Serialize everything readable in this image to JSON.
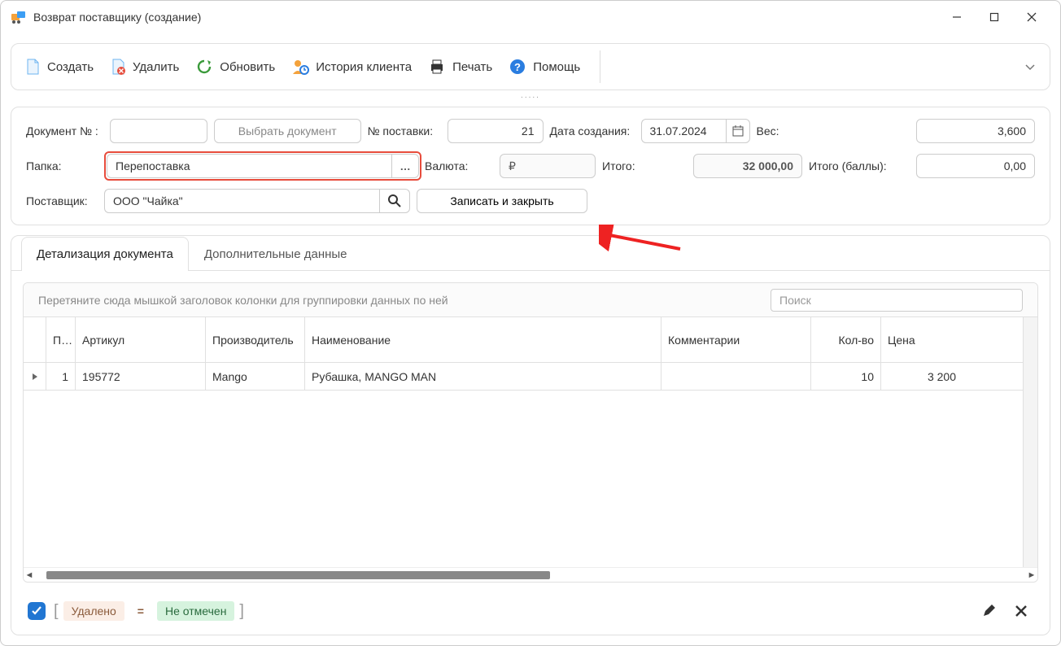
{
  "window": {
    "title": "Возврат поставщику (создание)"
  },
  "toolbar": {
    "create": "Создать",
    "delete": "Удалить",
    "refresh": "Обновить",
    "history": "История клиента",
    "print": "Печать",
    "help": "Помощь"
  },
  "form": {
    "doc_label": "Документ № :",
    "doc_value": "",
    "choose_doc": "Выбрать документ",
    "delivery_label": "№ поставки:",
    "delivery_value": "21",
    "date_label": "Дата создания:",
    "date_value": "31.07.2024",
    "weight_label": "Вес:",
    "weight_value": "3,600",
    "folder_label": "Папка:",
    "folder_value": "Перепоставка",
    "currency_label": "Валюта:",
    "currency_value": "₽",
    "total_label": "Итого:",
    "total_value": "32 000,00",
    "points_label": "Итого (баллы):",
    "points_value": "0,00",
    "supplier_label": "Поставщик:",
    "supplier_value": "ООО \"Чайка\"",
    "save_close": "Записать и закрыть"
  },
  "tabs": {
    "detail": "Детализация документа",
    "extra": "Дополнительные данные"
  },
  "grid": {
    "group_hint": "Перетяните сюда мышкой заголовок колонки для группировки данных по ней",
    "search_placeholder": "Поиск",
    "headers": {
      "n": "П…",
      "article": "Артикул",
      "mfr": "Производитель",
      "name": "Наименование",
      "comment": "Комментарии",
      "qty": "Кол-во",
      "price": "Цена"
    },
    "rows": [
      {
        "n": "1",
        "article": "195772",
        "mfr": "Mango",
        "name": "Рубашка, MANGO MAN",
        "comment": "",
        "qty": "10",
        "price": "3 200"
      }
    ]
  },
  "filter": {
    "deleted": "Удалено",
    "eq": "=",
    "unmarked": "Не отмечен"
  }
}
